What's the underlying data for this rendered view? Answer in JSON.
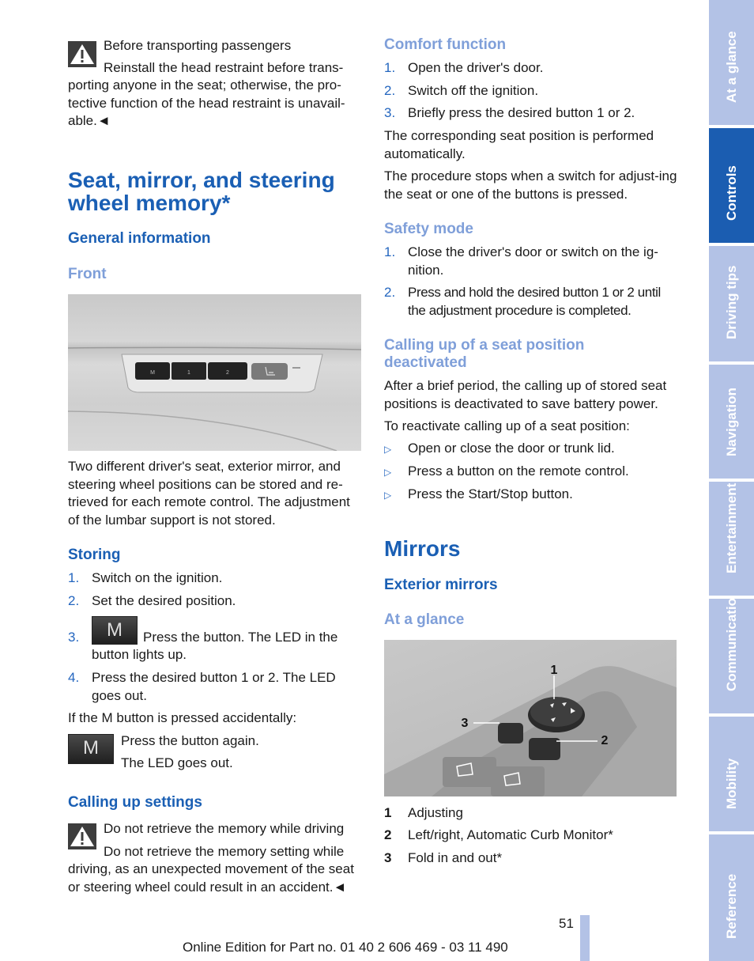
{
  "left_column": {
    "warning_1": {
      "icon": "warning-triangle-icon",
      "title": "Before transporting passengers",
      "body_line1": "Reinstall the head restraint before trans-",
      "body_rest": "porting anyone in the seat; otherwise, the pro-tective function of the head restraint is unavail-able.◄"
    },
    "main_title": "Seat, mirror, and steering wheel memory*",
    "general_info_heading": "General information",
    "front_heading": "Front",
    "front_image": {
      "description": "Memory button panel on seat side",
      "buttons": [
        "M",
        "1",
        "2"
      ],
      "extra_icon": "seat-adjust-icon"
    },
    "intro_paragraph": "Two different driver's seat, exterior mirror, and steering wheel positions can be stored and re-trieved for each remote control. The adjustment of the lumbar support is not stored.",
    "storing": {
      "heading": "Storing",
      "steps": [
        {
          "num": "1.",
          "text": "Switch on the ignition."
        },
        {
          "num": "2.",
          "text": "Set the desired position."
        },
        {
          "num": "3.",
          "button": "M",
          "text": "Press the button. The LED in the",
          "text_cont": "button lights up."
        },
        {
          "num": "4.",
          "text": "Press the desired button 1 or 2. The LED goes out."
        }
      ],
      "accidental_note": "If the M button is pressed accidentally:",
      "accidental_button": "M",
      "accidental_lines": [
        "Press the button again.",
        "The LED goes out."
      ]
    },
    "calling_up": {
      "heading": "Calling up settings",
      "warning": {
        "icon": "warning-triangle-icon",
        "title": "Do not retrieve the memory while driving",
        "body_line1": "Do not retrieve the memory setting while",
        "body_rest": "driving, as an unexpected movement of the seat or steering wheel could result in an accident.◄"
      }
    }
  },
  "right_column": {
    "comfort": {
      "heading": "Comfort function",
      "steps": [
        {
          "num": "1.",
          "text": "Open the driver's door."
        },
        {
          "num": "2.",
          "text": "Switch off the ignition."
        },
        {
          "num": "3.",
          "text": "Briefly press the desired button 1 or 2."
        }
      ],
      "para1": "The corresponding seat position is performed automatically.",
      "para2": "The procedure stops when a switch for adjust-ing the seat or one of the buttons is pressed."
    },
    "safety": {
      "heading": "Safety mode",
      "steps": [
        {
          "num": "1.",
          "text": "Close the driver's door or switch on the ig-nition."
        },
        {
          "num": "2.",
          "text": "Press and hold the desired button 1 or 2 until the adjustment procedure is completed."
        }
      ]
    },
    "deactivated": {
      "heading": "Calling up of a seat position deactivated",
      "para1": "After a brief period, the calling up of stored seat positions is deactivated to save battery power.",
      "para2": "To reactivate calling up of a seat position:",
      "bullets": [
        "Open or close the door or trunk lid.",
        "Press a button on the remote control.",
        "Press the Start/Stop button."
      ]
    },
    "mirrors_title": "Mirrors",
    "exterior_heading": "Exterior mirrors",
    "at_a_glance_heading": "At a glance",
    "mirror_image": {
      "callouts": [
        "1",
        "2",
        "3"
      ]
    },
    "legend": [
      {
        "num": "1",
        "text": "Adjusting"
      },
      {
        "num": "2",
        "text": "Left/right, Automatic Curb Monitor*"
      },
      {
        "num": "3",
        "text": "Fold in and out*"
      }
    ]
  },
  "sidebar": {
    "tabs": [
      {
        "label": "At a glance",
        "active": false
      },
      {
        "label": "Controls",
        "active": true
      },
      {
        "label": "Driving tips",
        "active": false
      },
      {
        "label": "Navigation",
        "active": false
      },
      {
        "label": "Entertainment",
        "active": false
      },
      {
        "label": "Communication",
        "active": false
      },
      {
        "label": "Mobility",
        "active": false
      },
      {
        "label": "Reference",
        "active": false
      }
    ]
  },
  "footer": {
    "page_number": "51",
    "edition_text": "Online Edition for Part no. 01 40 2 606 469 - 03 11 490"
  },
  "colors": {
    "heading_dark": "#1a5fb4",
    "heading_light": "#7f9fd9",
    "sidebar_tab": "#b3c2e6",
    "sidebar_active": "#1b5db1"
  }
}
